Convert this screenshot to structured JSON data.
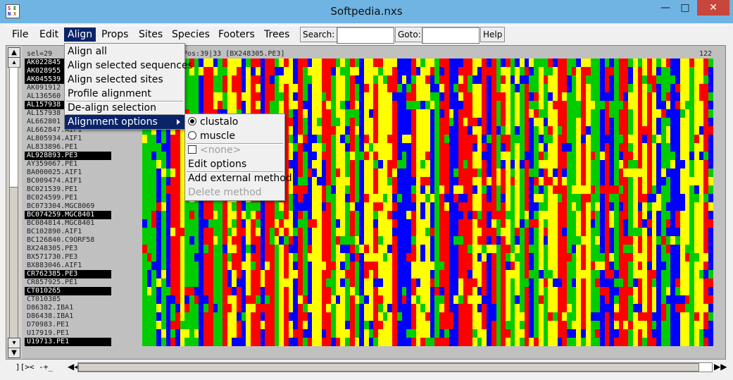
{
  "window": {
    "title": "Softpedia.nxs",
    "icon_letters": [
      "S",
      "E",
      "N",
      "X"
    ]
  },
  "menubar": {
    "items": [
      "File",
      "Edit",
      "Align",
      "Props",
      "Sites",
      "Species",
      "Footers",
      "Trees"
    ],
    "active_item": "Align",
    "search_label": "Search:",
    "search_value": "",
    "goto_label": "Goto:",
    "goto_value": "",
    "help_label": "Help"
  },
  "align_menu": {
    "items": [
      "Align all",
      "Align selected sequences",
      "Align selected sites",
      "Profile alignment",
      "De-align selection",
      "Alignment options"
    ],
    "highlighted": "Alignment options"
  },
  "alignment_options_menu": {
    "methods": [
      {
        "label": "clustalo",
        "selected": true
      },
      {
        "label": "muscle",
        "selected": false
      }
    ],
    "none_label": "<none>",
    "edit_label": "Edit options",
    "add_label": "Add external method",
    "delete_label": "Delete method"
  },
  "status": {
    "sel": "sel=29",
    "pos": "Pos:39|33 [BX248305.PE3]",
    "length": "122"
  },
  "sequences": [
    {
      "name": "AK022845",
      "selected": true
    },
    {
      "name": "AK028955",
      "selected": true
    },
    {
      "name": "AK045539",
      "selected": true
    },
    {
      "name": "AK091912",
      "selected": false
    },
    {
      "name": "AL136560",
      "selected": false
    },
    {
      "name": "AL157938",
      "selected": true
    },
    {
      "name": "AL157938",
      "selected": false
    },
    {
      "name": "AL662801",
      "selected": false
    },
    {
      "name": "AL662847.AIF1",
      "selected": false
    },
    {
      "name": "AL805934.AIF1",
      "selected": false
    },
    {
      "name": "AL833896.PE1",
      "selected": false
    },
    {
      "name": "AL928893.PE3",
      "selected": true
    },
    {
      "name": "AY359067.PE1",
      "selected": false
    },
    {
      "name": "BA000025.AIF1",
      "selected": false
    },
    {
      "name": "BC009474.AIF1",
      "selected": false
    },
    {
      "name": "BC021539.PE1",
      "selected": false
    },
    {
      "name": "BC024599.PE1",
      "selected": false
    },
    {
      "name": "BC073304.MGC8069",
      "selected": false
    },
    {
      "name": "BC074259.MGC8401",
      "selected": true
    },
    {
      "name": "BC084814.MGC8401",
      "selected": false
    },
    {
      "name": "BC102890.AIF1",
      "selected": false
    },
    {
      "name": "BC126840.C9ORF58",
      "selected": false
    },
    {
      "name": "BX248305.PE3",
      "selected": false
    },
    {
      "name": "BX571730.PE3",
      "selected": false
    },
    {
      "name": "BX883046.AIF1",
      "selected": false
    },
    {
      "name": "CR762385.PE3",
      "selected": true
    },
    {
      "name": "CR857925.PE1",
      "selected": false
    },
    {
      "name": "CT010265",
      "selected": true
    },
    {
      "name": "CT010385",
      "selected": false
    },
    {
      "name": "D86382.IBA1",
      "selected": false
    },
    {
      "name": "D86438.IBA1",
      "selected": false
    },
    {
      "name": "D70983.PE1",
      "selected": false
    },
    {
      "name": "U17919.PE1",
      "selected": false
    },
    {
      "name": "U19713.PE1",
      "selected": true
    }
  ],
  "navigation": {
    "text": "][>< -+_"
  },
  "colors": {
    "A": "#ff0000",
    "C": "#00cc00",
    "G": "#ffff00",
    "T": "#0000ff",
    "highlight": "#0a246a"
  }
}
